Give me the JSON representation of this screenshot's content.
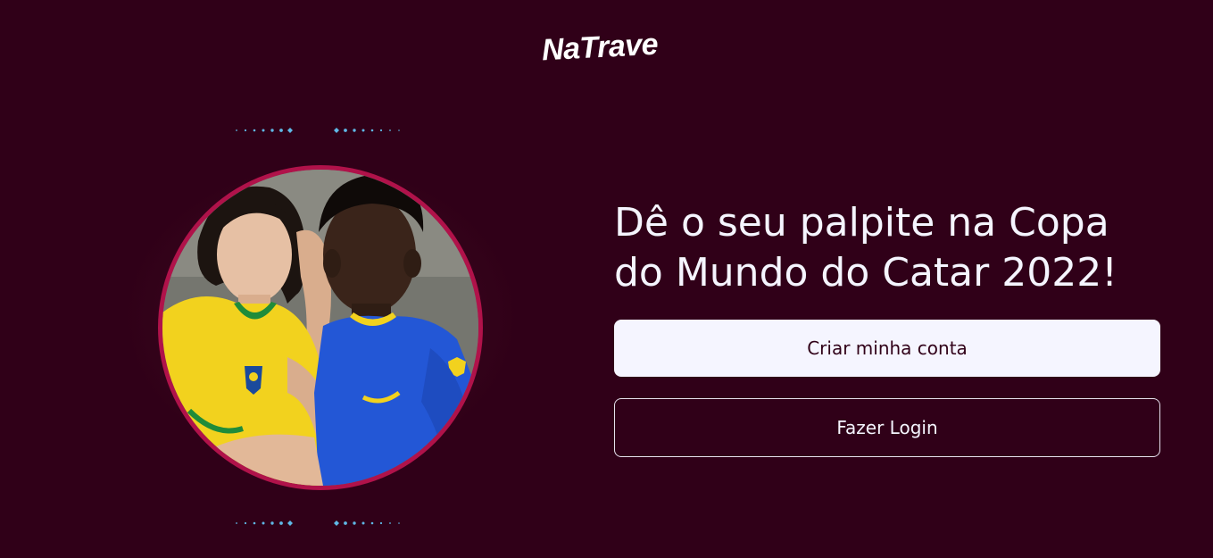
{
  "brand": {
    "logo_text": "NaTrave"
  },
  "hero": {
    "image_alt": "Duas pessoas vestindo camisas da seleção brasileira"
  },
  "main": {
    "headline": "Dê o seu palpite na Copa do Mundo do Catar 2022!",
    "create_account_label": "Criar minha conta",
    "login_label": "Fazer Login"
  },
  "colors": {
    "background": "#300018",
    "accent_ring": "#b0124a",
    "button_light": "#f5f5ff",
    "dot_accent": "#5fb8e6"
  }
}
